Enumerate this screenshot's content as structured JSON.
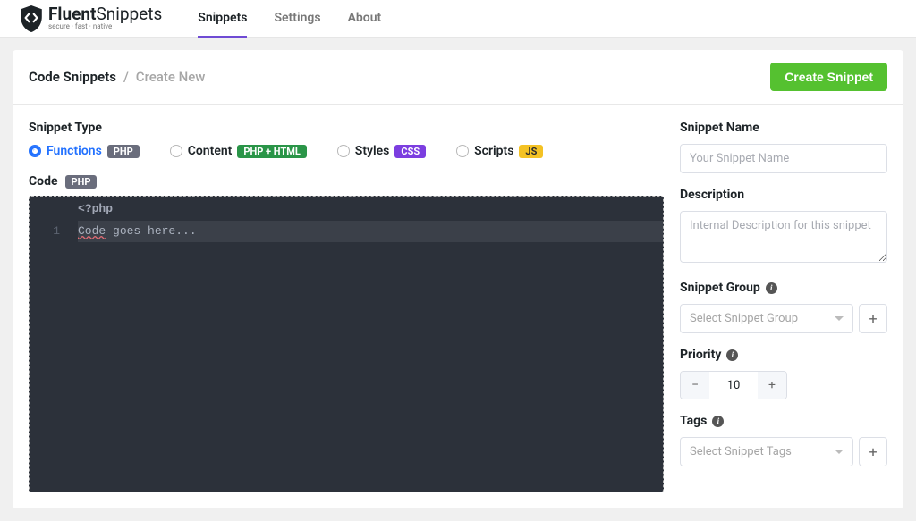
{
  "brand": {
    "name": "FluentSnippets",
    "first": "Fluent",
    "second": "Snippets",
    "tagline": "secure · fast · native"
  },
  "nav": {
    "tabs": [
      "Snippets",
      "Settings",
      "About"
    ],
    "active": 0
  },
  "breadcrumb": {
    "root": "Code Snippets",
    "current": "Create New"
  },
  "actions": {
    "create": "Create Snippet"
  },
  "typeSection": {
    "heading": "Snippet Type",
    "options": [
      {
        "label": "Functions",
        "badge": "PHP",
        "badgeClass": "badge-php",
        "selected": true
      },
      {
        "label": "Content",
        "badge": "PHP + HTML",
        "badgeClass": "badge-phphtml",
        "selected": false
      },
      {
        "label": "Styles",
        "badge": "CSS",
        "badgeClass": "badge-css",
        "selected": false
      },
      {
        "label": "Scripts",
        "badge": "JS",
        "badgeClass": "badge-js",
        "selected": false
      }
    ]
  },
  "codeSection": {
    "heading": "Code",
    "badge": "PHP",
    "openTag": "<?php",
    "lineNumber": "1",
    "codePrefix": "Code",
    "codeRest": " goes here..."
  },
  "sidebar": {
    "name": {
      "label": "Snippet Name",
      "placeholder": "Your Snippet Name",
      "value": ""
    },
    "description": {
      "label": "Description",
      "placeholder": "Internal Description for this snippet",
      "value": ""
    },
    "group": {
      "label": "Snippet Group",
      "placeholder": "Select Snippet Group"
    },
    "priority": {
      "label": "Priority",
      "value": "10"
    },
    "tags": {
      "label": "Tags",
      "placeholder": "Select Snippet Tags"
    }
  }
}
